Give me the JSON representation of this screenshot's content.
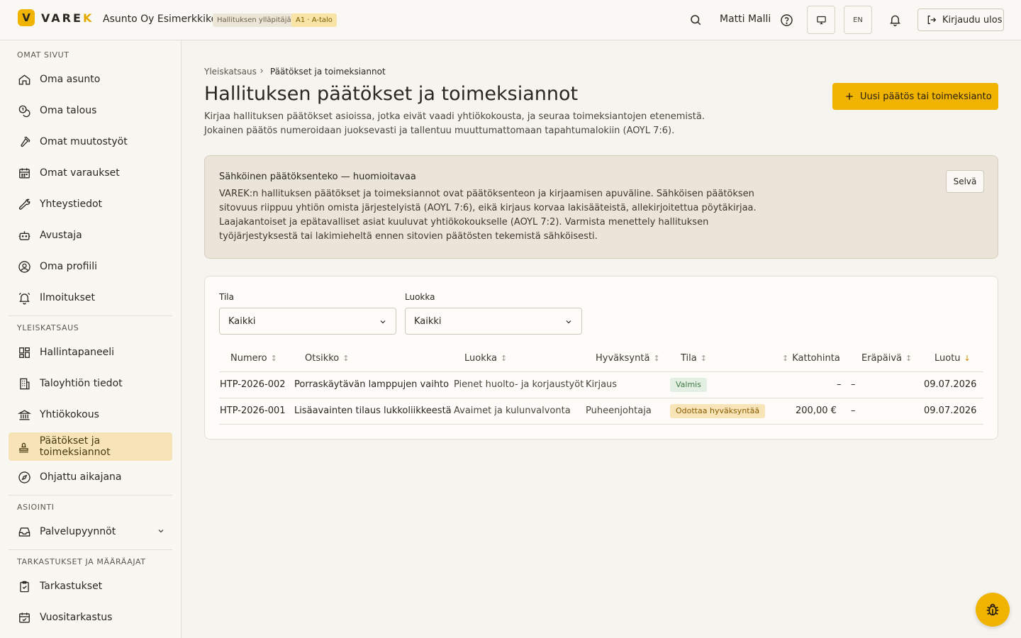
{
  "header": {
    "logo_letter": "V",
    "logo_word_main": "VARE",
    "logo_word_accent": "K",
    "org_name": "Asunto Oy Esimerkkikoti",
    "role_badge": "Hallituksen ylläpitäjä",
    "apartment_badge": "A1 · A-talo",
    "user_name": "Matti Malli",
    "lang_label": "EN",
    "logout_label": "Kirjaudu ulos",
    "accent_color": "#f0b400"
  },
  "sidebar": {
    "sections": [
      {
        "title": "OMAT SIVUT",
        "items": [
          {
            "label": "Oma asunto",
            "icon": "home-icon"
          },
          {
            "label": "Oma talous",
            "icon": "coins-icon"
          },
          {
            "label": "Omat muutostyöt",
            "icon": "hammer-icon"
          },
          {
            "label": "Omat varaukset",
            "icon": "calendar-icon"
          },
          {
            "label": "Yhteystiedot",
            "icon": "wrench-icon"
          },
          {
            "label": "Avustaja",
            "icon": "bot-icon"
          },
          {
            "label": "Oma profiili",
            "icon": "user-circle-icon"
          },
          {
            "label": "Ilmoitukset",
            "icon": "bell-ring-icon"
          }
        ]
      },
      {
        "title": "YLEISKATSAUS",
        "items": [
          {
            "label": "Hallintapaneeli",
            "icon": "dashboard-icon"
          },
          {
            "label": "Taloyhtiön tiedot",
            "icon": "building-icon"
          },
          {
            "label": "Yhtiökokous",
            "icon": "landmark-icon"
          },
          {
            "label": "Päätökset ja toimeksiannot",
            "icon": "stamp-icon",
            "active": true
          },
          {
            "label": "Ohjattu aikajana",
            "icon": "compass-icon"
          }
        ]
      },
      {
        "title": "ASIOINTI",
        "items": [
          {
            "label": "Palvelupyynnöt",
            "icon": "inbox-icon",
            "expandable": true
          }
        ]
      },
      {
        "title": "TARKASTUKSET JA MÄÄRÄAJAT",
        "items": [
          {
            "label": "Tarkastukset",
            "icon": "clipboard-check-icon"
          },
          {
            "label": "Vuositarkastus",
            "icon": "calendar-check-icon"
          }
        ]
      }
    ]
  },
  "breadcrumb": {
    "home": "Yleiskatsaus",
    "current": "Päätökset ja toimeksiannot"
  },
  "page": {
    "title": "Hallituksen päätökset ja toimeksiannot",
    "description": "Kirjaa hallituksen päätökset asioissa, jotka eivät vaadi yhtiökokousta, ja seuraa toimeksiantojen etenemistä. Jokainen päätös numeroidaan juoksevasti ja tallentuu muuttumattomaan tapahtumalokiin (AOYL 7:6).",
    "new_button": "Uusi päätös tai toimeksianto"
  },
  "notice": {
    "title": "Sähköinen päätöksenteko — huomioitavaa",
    "text": "VAREK:n hallituksen päätökset ja toimeksiannot ovat päätöksenteon ja kirjaamisen apuväline. Sähköisen päätöksen sitovuus riippuu yhtiön omista järjestelyistä (AOYL 7:6), eikä kirjaus korvaa lakisääteistä, allekirjoitettua pöytäkirjaa. Laajakantoiset ja epätavalliset asiat kuuluvat yhtiökokoukselle (AOYL 7:2). Varmista menettely hallituksen työjärjestyksestä tai lakimieheltä ennen sitovien päätösten tekemistä sähköisesti.",
    "dismiss": "Selvä"
  },
  "filters": {
    "status_label": "Tila",
    "status_value": "Kaikki",
    "category_label": "Luokka",
    "category_value": "Kaikki"
  },
  "table": {
    "columns": [
      "Numero",
      "Otsikko",
      "Luokka",
      "Hyväksyntä",
      "Tila",
      "Kattohinta",
      "Eräpäivä",
      "Luotu"
    ],
    "rows": [
      {
        "number": "HTP-2026-002",
        "title": "Porraskäytävän lamppujen vaihto",
        "category": "Pienet huolto- ja korjaustyöt",
        "approval": "Kirjaus",
        "status": "Valmis",
        "status_kind": "done",
        "price": "–",
        "due": "–",
        "created": "09.07.2026"
      },
      {
        "number": "HTP-2026-001",
        "title": "Lisäavainten tilaus lukkoliikkeestä",
        "category": "Avaimet ja kulunvalvonta",
        "approval": "Puheenjohtaja",
        "status": "Odottaa hyväksyntää",
        "status_kind": "wait",
        "price": "200,00 €",
        "due": "–",
        "created": "09.07.2026"
      }
    ]
  }
}
